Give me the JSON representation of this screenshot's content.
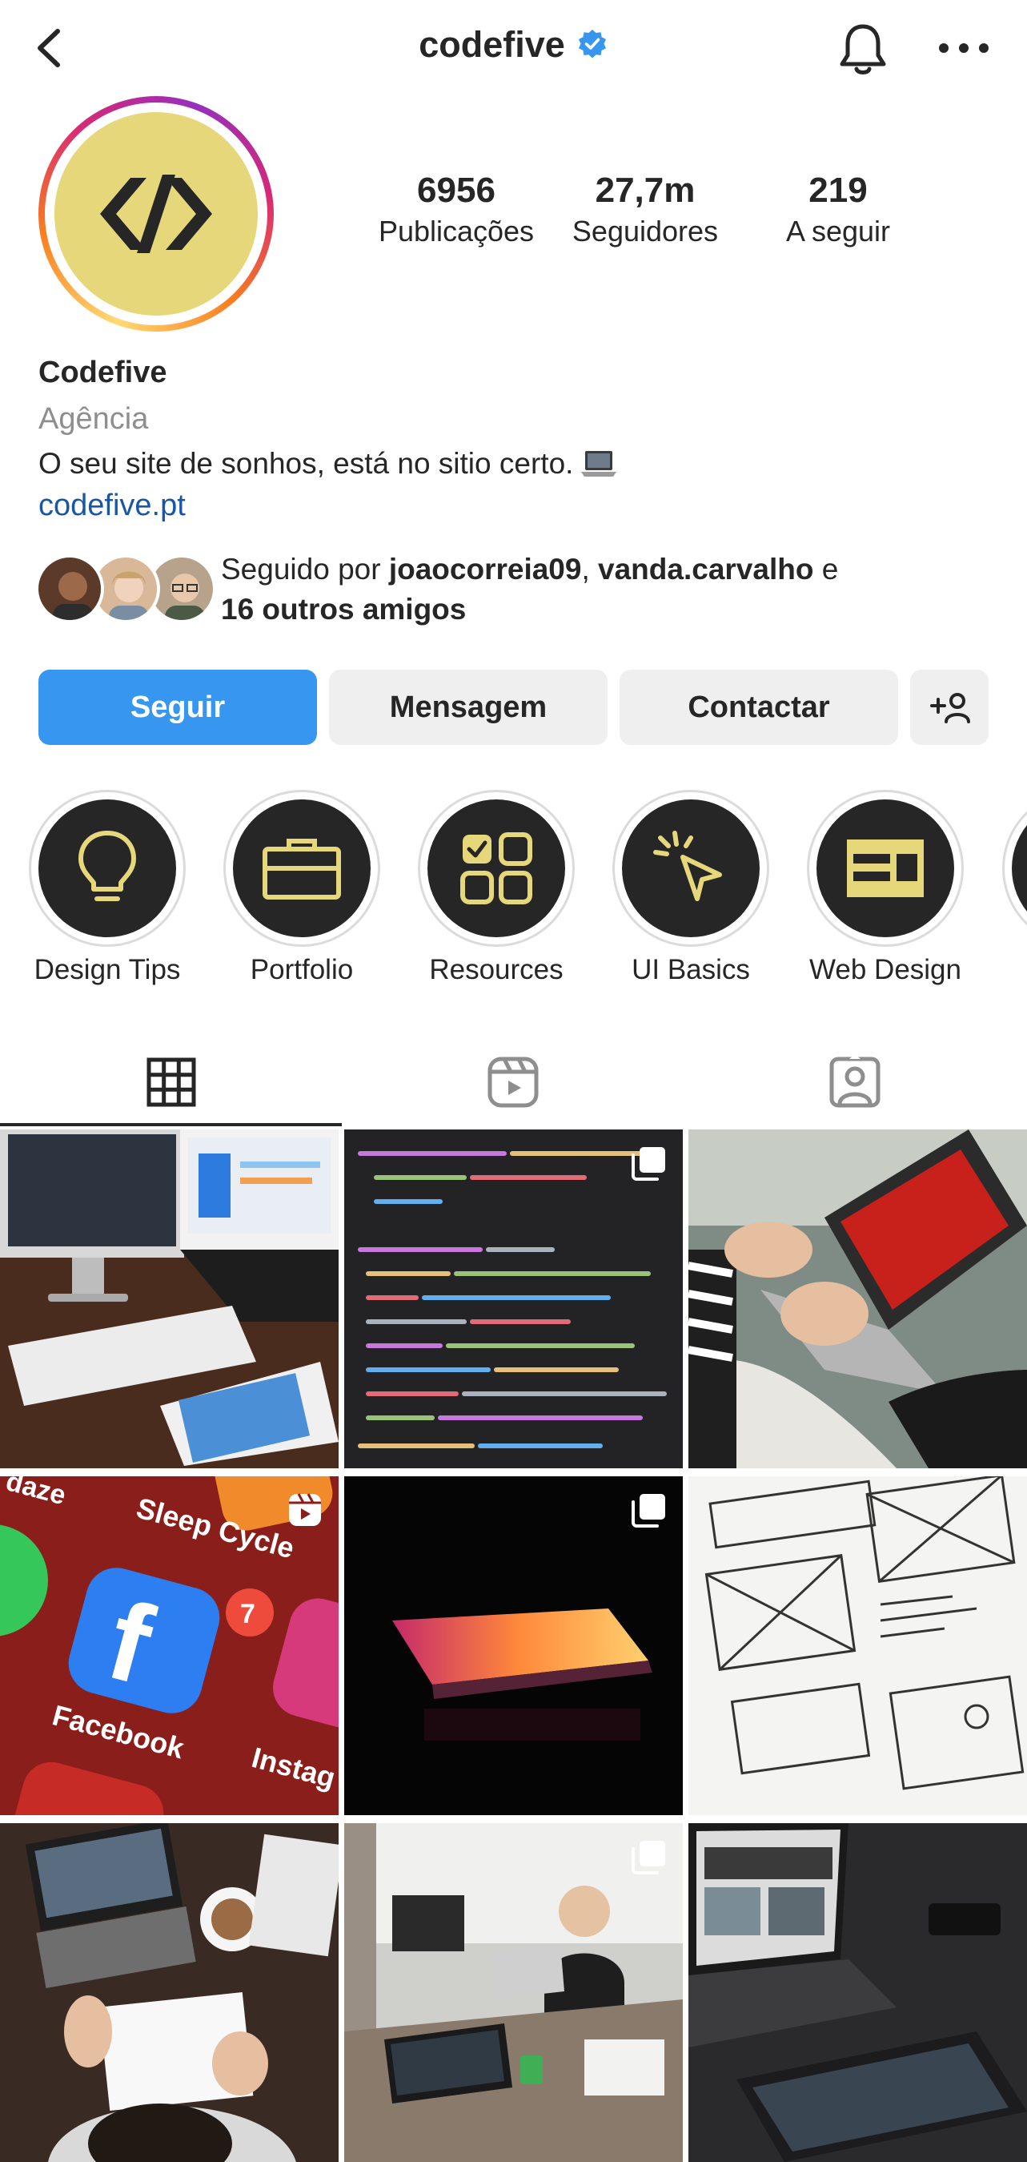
{
  "header": {
    "username": "codefive",
    "verified": true
  },
  "profile": {
    "stats": [
      {
        "value": "6956",
        "label": "Publicações"
      },
      {
        "value": "27,7m",
        "label": "Seguidores"
      },
      {
        "value": "219",
        "label": "A seguir"
      }
    ],
    "name": "Codefive",
    "category": "Agência",
    "bio": "O seu site de sonhos, está no sitio certo.",
    "link": "codefive.pt"
  },
  "followed_by": {
    "prefix": "Seguido por ",
    "user1": "joaocorreia09",
    "sep": ", ",
    "user2": "vanda.carvalho",
    "conj": " e",
    "others": "16 outros amigos"
  },
  "actions": {
    "follow": "Seguir",
    "message": "Mensagem",
    "contact": "Contactar"
  },
  "highlights": [
    {
      "label": "Design Tips",
      "icon": "lightbulb-icon"
    },
    {
      "label": "Portfolio",
      "icon": "briefcase-icon"
    },
    {
      "label": "Resources",
      "icon": "grid-apps-icon"
    },
    {
      "label": "UI Basics",
      "icon": "cursor-click-icon"
    },
    {
      "label": "Web Design",
      "icon": "layout-icon"
    }
  ],
  "colors": {
    "primary_blue": "#3797f0",
    "secondary_button": "#efefef",
    "brand_yellow": "#e5d77a",
    "text": "#262626",
    "muted": "#8e8e8e",
    "link": "#1a56a6",
    "notification_badge": "#ee4b3c"
  },
  "grid": {
    "posts": [
      {
        "subject": "imac-macbook-desk",
        "badge": null
      },
      {
        "subject": "code-screen",
        "badge": "carousel-icon"
      },
      {
        "subject": "laptop-lap-typing",
        "badge": null
      },
      {
        "subject": "phone-app-icons",
        "badge": "reels-icon"
      },
      {
        "subject": "laptop-dark-glow",
        "badge": "carousel-icon"
      },
      {
        "subject": "wireframe-sketch",
        "badge": null
      },
      {
        "subject": "desk-top-view",
        "badge": null
      },
      {
        "subject": "office-workers",
        "badge": "carousel-icon"
      },
      {
        "subject": "laptop-dark-desk",
        "badge": null
      }
    ]
  },
  "app_icons": {
    "sleep_cycle": "Sleep Cycle",
    "facebook": "Facebook",
    "facebook_badge": "7",
    "instagram": "Instag",
    "top_partial": "daze"
  }
}
